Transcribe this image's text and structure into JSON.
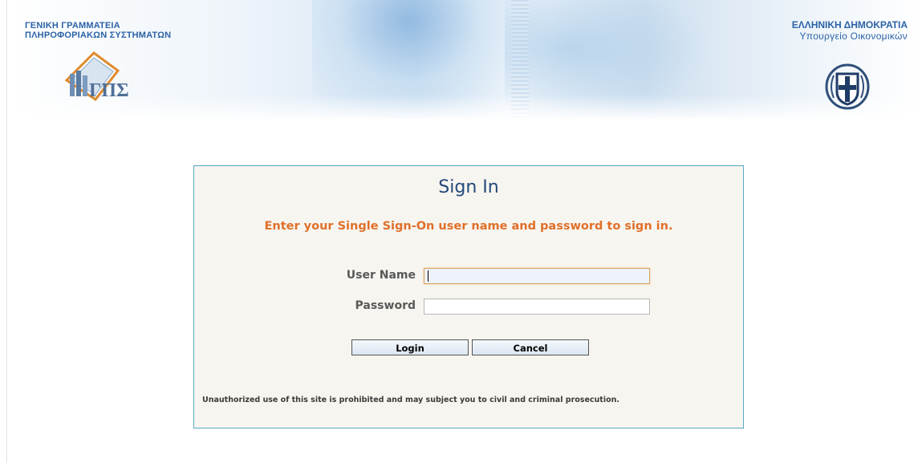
{
  "header": {
    "left_title_line1": "ΓΕΝΙΚΗ ΓΡΑΜΜΑΤΕΙΑ",
    "left_title_line2": "ΠΛΗΡΟΦΟΡΙΑΚΩΝ ΣΥΣΤΗΜΑΤΩΝ",
    "right_title_line1": "ΕΛΛΗΝΙΚΗ ΔΗΜΟΚΡΑΤΙΑ",
    "right_title_line2": "Υπουργείο Οικονομικών",
    "logo_letters": "ΓΓΠΣ",
    "brand_color": "#2b62a6"
  },
  "signin": {
    "title": "Sign In",
    "instruction": "Enter your Single Sign-On user name and password to sign in.",
    "username_label": "User Name",
    "username_value": "",
    "password_label": "Password",
    "password_value": "",
    "login_label": "Login",
    "cancel_label": "Cancel",
    "disclaimer": "Unauthorized use of this site is prohibited and may subject you to civil and criminal prosecution.",
    "title_color": "#24497a",
    "instruction_color": "#e0702a",
    "border_color": "#57a8c9"
  }
}
